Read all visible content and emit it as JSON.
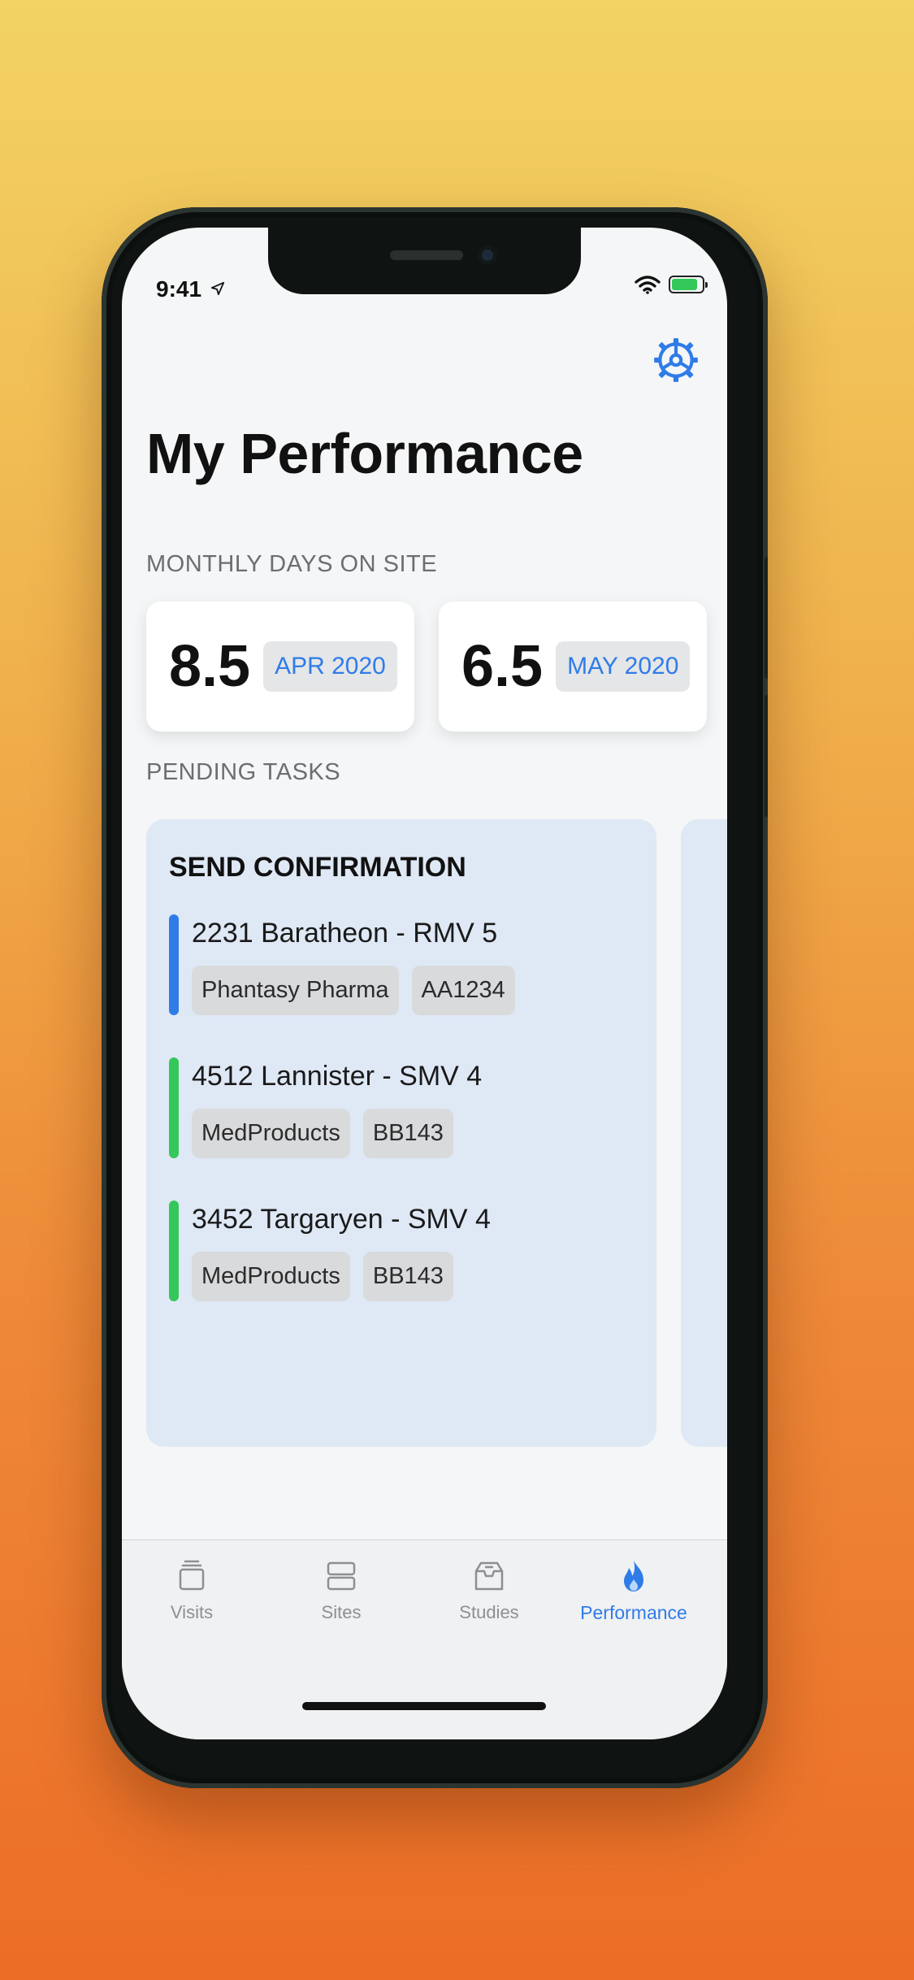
{
  "status_bar": {
    "time": "9:41",
    "battery_level": 0.85
  },
  "page": {
    "title": "My Performance",
    "settings_icon": "gear-icon"
  },
  "monthly_days": {
    "label": "MONTHLY DAYS ON SITE",
    "cards": [
      {
        "value": "8.5",
        "month": "APR 2020"
      },
      {
        "value": "6.5",
        "month": "MAY 2020"
      }
    ]
  },
  "pending_tasks": {
    "label": "PENDING TASKS",
    "card": {
      "title": "SEND CONFIRMATION",
      "items": [
        {
          "title": "2231 Baratheon - RMV 5",
          "tags": [
            "Phantasy Pharma",
            "AA1234"
          ],
          "accent": "#2f7ce8"
        },
        {
          "title": "4512 Lannister - SMV 4",
          "tags": [
            "MedProducts",
            "BB143"
          ],
          "accent": "#34c759"
        },
        {
          "title": "3452 Targaryen - SMV 4",
          "tags": [
            "MedProducts",
            "BB143"
          ],
          "accent": "#34c759"
        }
      ]
    }
  },
  "tab_bar": {
    "tabs": [
      {
        "label": "Visits",
        "icon": "stack-icon"
      },
      {
        "label": "Sites",
        "icon": "server-icon"
      },
      {
        "label": "Studies",
        "icon": "archive-box-icon"
      },
      {
        "label": "Performance",
        "icon": "flame-icon",
        "active": true
      }
    ]
  },
  "colors": {
    "accent": "#2f7ce8",
    "success": "#34c759",
    "task_card_bg": "#dfe8f5"
  }
}
